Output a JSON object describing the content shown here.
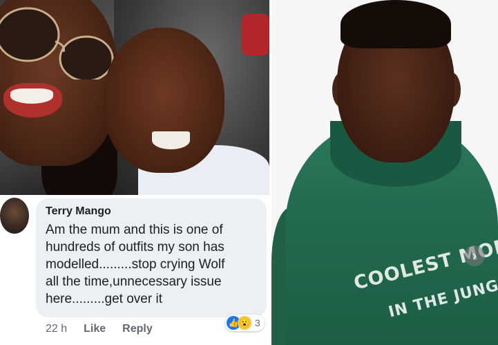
{
  "comment": {
    "author": "Terry Mango",
    "text": "Am the mum and this is one of\nhundreds of outfits my son has\nmodelled.........stop crying Wolf\nall the time,unnecessary issue\nhere.........get over it",
    "time": "22 h",
    "like_label": "Like",
    "reply_label": "Reply",
    "reactions": {
      "icons": [
        "like-reaction-icon",
        "wow-reaction-icon"
      ],
      "count": "3"
    }
  },
  "hoodie_print": {
    "line1": "COOLEST MONK",
    "line2": "IN THE JUNGLE"
  },
  "colors": {
    "hoodie_green": "#236a4f",
    "bubble_gray": "#eceff3",
    "facebook_blue": "#1877f2"
  },
  "icons": {
    "next": "chevron-right-icon"
  }
}
